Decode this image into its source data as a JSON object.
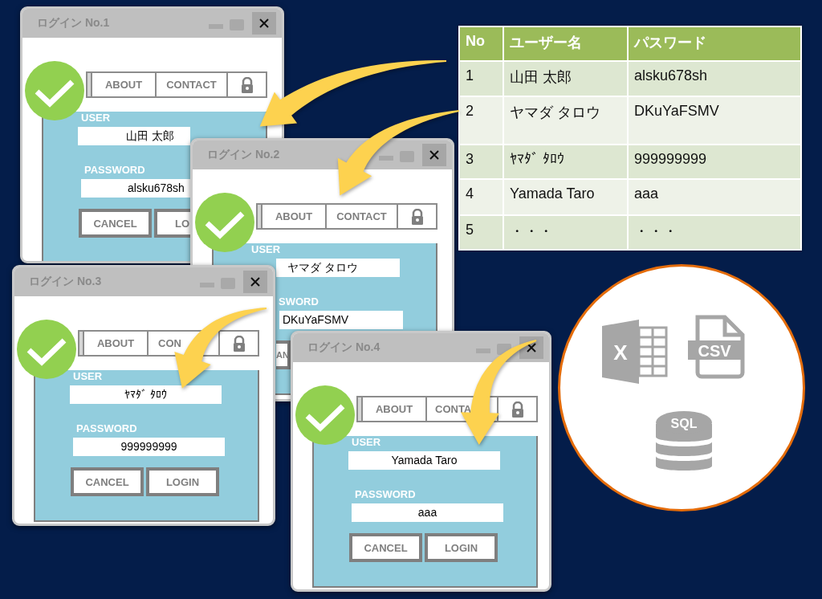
{
  "windows": [
    {
      "title": "ログイン No.1",
      "tabs": [
        "ABOUT",
        "CONTACT"
      ],
      "user_label": "USER",
      "user": "山田 太郎",
      "password_label": "PASSWORD",
      "password": "alsku678sh",
      "buttons": [
        "CANCEL",
        "LO"
      ]
    },
    {
      "title": "ログイン No.2",
      "tabs": [
        "ABOUT",
        "CONTACT"
      ],
      "user_label": "USER",
      "user": "ヤマダ タロウ",
      "password_label": "SWORD",
      "password": "DKuYaFSMV",
      "buttons": [
        "AN"
      ]
    },
    {
      "title": "ログイン No.3",
      "tabs": [
        "ABOUT",
        "CON"
      ],
      "user_label": "USER",
      "user": "ﾔﾏﾀﾞ ﾀﾛｳ",
      "password_label": "PASSWORD",
      "password": "999999999",
      "buttons": [
        "CANCEL",
        "LOGIN"
      ]
    },
    {
      "title": "ログイン No.4",
      "tabs": [
        "ABOUT",
        "CONTA"
      ],
      "user_label": "USER",
      "user": "Yamada Taro",
      "password_label": "PASSWORD",
      "password": "aaa",
      "buttons": [
        "CANCEL",
        "LOGIN"
      ]
    }
  ],
  "table": {
    "columns": [
      "No",
      "ユーザー名",
      "パスワード"
    ],
    "rows": [
      [
        "1",
        "山田 太郎",
        "alsku678sh"
      ],
      [
        "2",
        "ヤマダ タロウ",
        "DKuYaFSMV"
      ],
      [
        "3",
        "ﾔﾏﾀﾞ ﾀﾛｳ",
        "999999999"
      ],
      [
        "4",
        "Yamada Taro",
        "aaa"
      ],
      [
        "5",
        "・・・",
        "・・・"
      ]
    ]
  },
  "formats": {
    "labels": [
      "X",
      "CSV",
      "SQL"
    ]
  }
}
